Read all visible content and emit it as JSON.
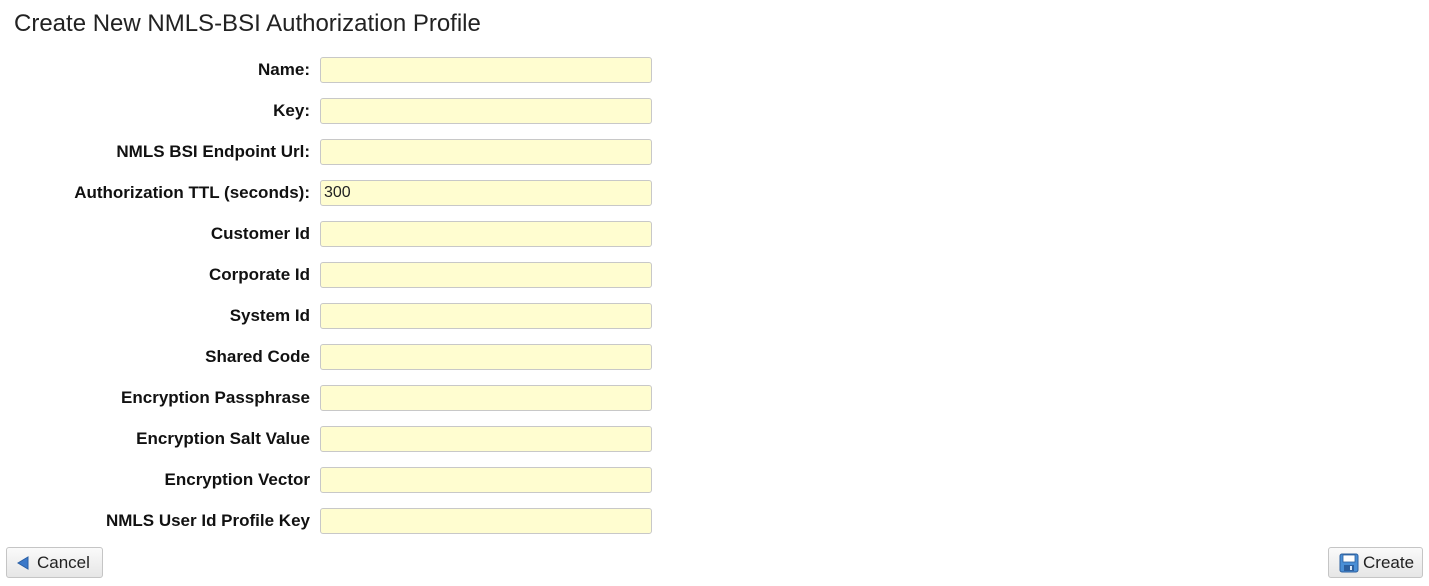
{
  "page_title": "Create New NMLS-BSI Authorization Profile",
  "fields": [
    {
      "label": "Name:",
      "value": "",
      "name": "name-input"
    },
    {
      "label": "Key:",
      "value": "",
      "name": "key-input"
    },
    {
      "label": "NMLS BSI Endpoint Url:",
      "value": "",
      "name": "endpoint-url-input"
    },
    {
      "label": "Authorization TTL (seconds):",
      "value": "300",
      "name": "authorization-ttl-input"
    },
    {
      "label": "Customer Id",
      "value": "",
      "name": "customer-id-input"
    },
    {
      "label": "Corporate Id",
      "value": "",
      "name": "corporate-id-input"
    },
    {
      "label": "System Id",
      "value": "",
      "name": "system-id-input"
    },
    {
      "label": "Shared Code",
      "value": "",
      "name": "shared-code-input"
    },
    {
      "label": "Encryption Passphrase",
      "value": "",
      "name": "encryption-passphrase-input"
    },
    {
      "label": "Encryption Salt Value",
      "value": "",
      "name": "encryption-salt-value-input"
    },
    {
      "label": "Encryption Vector",
      "value": "",
      "name": "encryption-vector-input"
    },
    {
      "label": "NMLS User Id Profile Key",
      "value": "",
      "name": "nmls-user-id-profile-key-input"
    }
  ],
  "buttons": {
    "cancel_label": "Cancel",
    "cancel_icon": "arrow-left-icon",
    "create_label": "Create",
    "create_icon": "save-icon"
  },
  "colors": {
    "input_background": "#fffdd0",
    "input_border": "#c8c8c8",
    "cancel_icon": "#3a78c9",
    "create_icon": "#4a8fd6"
  }
}
